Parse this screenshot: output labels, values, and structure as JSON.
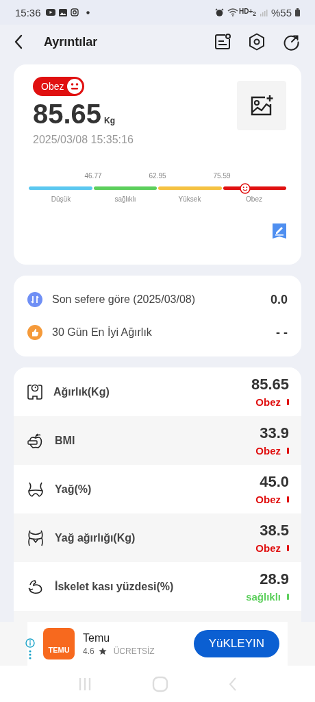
{
  "status_bar": {
    "time": "15:36",
    "network": "HD+$_{2}$",
    "battery": "%55"
  },
  "header": {
    "title": "Ayrıntılar"
  },
  "summary": {
    "badge": "Obez",
    "weight": "85.65",
    "unit": "Kg",
    "datetime": "2025/03/08 15:35:16",
    "gauge": {
      "level": 0.84,
      "thresholds": [
        "46.77",
        "62.95",
        "75.59"
      ],
      "segments": [
        {
          "label": "Düşük",
          "color": "#5bc8f0"
        },
        {
          "label": "sağlıklı",
          "color": "#5ccf5c"
        },
        {
          "label": "Yüksek",
          "color": "#f5c242"
        },
        {
          "label": "Obez",
          "color": "#e01010"
        }
      ]
    }
  },
  "comparison": [
    {
      "kind": "change",
      "label": "Son sefere göre (2025/03/08)",
      "value": "0.0"
    },
    {
      "kind": "best",
      "label": "30 Gün En İyi Ağırlık",
      "value": "- -"
    }
  ],
  "metrics": [
    {
      "kind": "scale",
      "name": "Ağırlık(Kg)",
      "value": "85.65",
      "status": "Obez",
      "color": "#e01010"
    },
    {
      "kind": "apple",
      "name": "BMI",
      "value": "33.9",
      "status": "Obez",
      "color": "#e01010"
    },
    {
      "kind": "waist",
      "name": "Yağ(%)",
      "value": "45.0",
      "status": "Obez",
      "color": "#e01010"
    },
    {
      "kind": "belly",
      "name": "Yağ ağırlığı(Kg)",
      "value": "38.5",
      "status": "Obez",
      "color": "#e01010"
    },
    {
      "kind": "muscle",
      "name": "İskelet kası yüzdesi(%)",
      "value": "28.9",
      "status": "sağlıklı",
      "color": "#5ccf5c"
    }
  ],
  "ad": {
    "app": "Temu",
    "logo_text": "TEMU",
    "rating": "4.6",
    "price": "ÜCRETSİZ",
    "button": "YüKLEYIN"
  }
}
